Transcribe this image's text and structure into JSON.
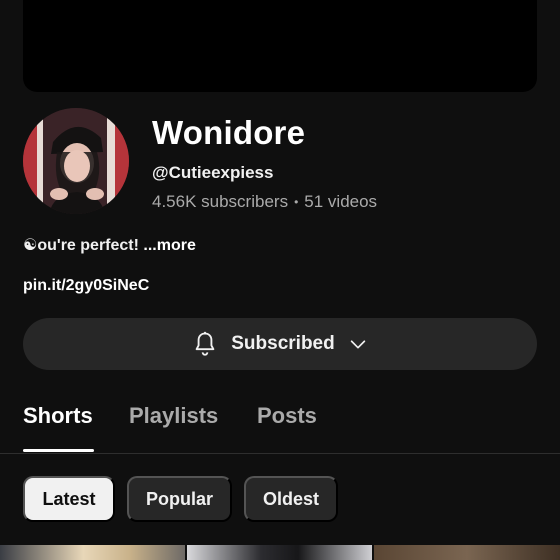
{
  "channel": {
    "name": "Wonidore",
    "handle": "@Cutieexpiess",
    "subscribers": "4.56K subscribers",
    "separator": "•",
    "videos": "51 videos",
    "description": "☯ou're perfect!",
    "more_label": "...more",
    "link": "pin.it/2gy0SiNeC"
  },
  "subscribe_button": {
    "label": "Subscribed",
    "bell_icon": "bell-icon",
    "chevron_icon": "chevron-down-icon"
  },
  "tabs": [
    {
      "label": "Shorts",
      "active": true
    },
    {
      "label": "Playlists",
      "active": false
    },
    {
      "label": "Posts",
      "active": false
    }
  ],
  "filters": [
    {
      "label": "Latest",
      "selected": true
    },
    {
      "label": "Popular",
      "selected": false
    },
    {
      "label": "Oldest",
      "selected": false
    }
  ],
  "colors": {
    "background": "#0f0f0f",
    "button": "#272727",
    "secondary_text": "#aaaaaa",
    "selected_chip": "#f1f1f1"
  }
}
